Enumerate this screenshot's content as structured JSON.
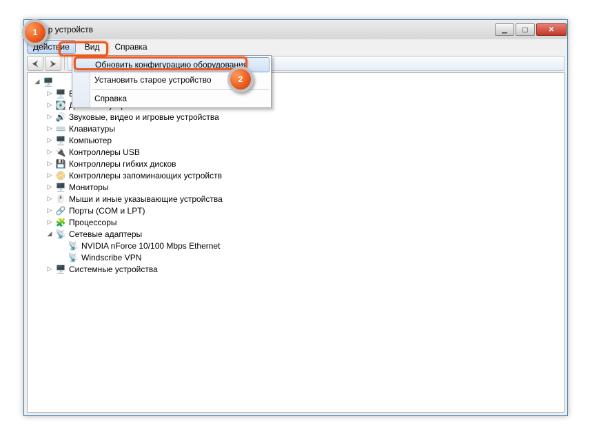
{
  "window": {
    "title_suffix": "етчер устройств"
  },
  "menubar": {
    "file_hidden": "",
    "action": "Действие",
    "view": "Вид",
    "help": "Справка"
  },
  "dropdown": {
    "scan": "Обновить конфигурацию оборудования",
    "legacy": "Установить старое устройство",
    "help": "Справка"
  },
  "tree": {
    "root_icon": "🖥️",
    "nodes": [
      {
        "label": "Видеоадаптеры",
        "icon": "🖥️"
      },
      {
        "label": "Дисковые устройства",
        "icon": "💽"
      },
      {
        "label": "Звуковые, видео и игровые устройства",
        "icon": "🔊"
      },
      {
        "label": "Клавиатуры",
        "icon": "⌨️"
      },
      {
        "label": "Компьютер",
        "icon": "🖥️"
      },
      {
        "label": "Контроллеры USB",
        "icon": "🔌"
      },
      {
        "label": "Контроллеры гибких дисков",
        "icon": "💾"
      },
      {
        "label": "Контроллеры запоминающих устройств",
        "icon": "📀"
      },
      {
        "label": "Мониторы",
        "icon": "🖥️"
      },
      {
        "label": "Мыши и иные указывающие устройства",
        "icon": "🖱️"
      },
      {
        "label": "Порты (COM и LPT)",
        "icon": "🔗"
      },
      {
        "label": "Процессоры",
        "icon": "🧩"
      },
      {
        "label": "Сетевые адаптеры",
        "icon": "📡",
        "expanded": true,
        "children": [
          {
            "label": "NVIDIA nForce 10/100 Mbps Ethernet",
            "icon": "📡"
          },
          {
            "label": "Windscribe VPN",
            "icon": "📡"
          }
        ]
      },
      {
        "label": "Системные устройства",
        "icon": "🖥️"
      }
    ]
  },
  "badges": {
    "one": "1",
    "two": "2"
  }
}
